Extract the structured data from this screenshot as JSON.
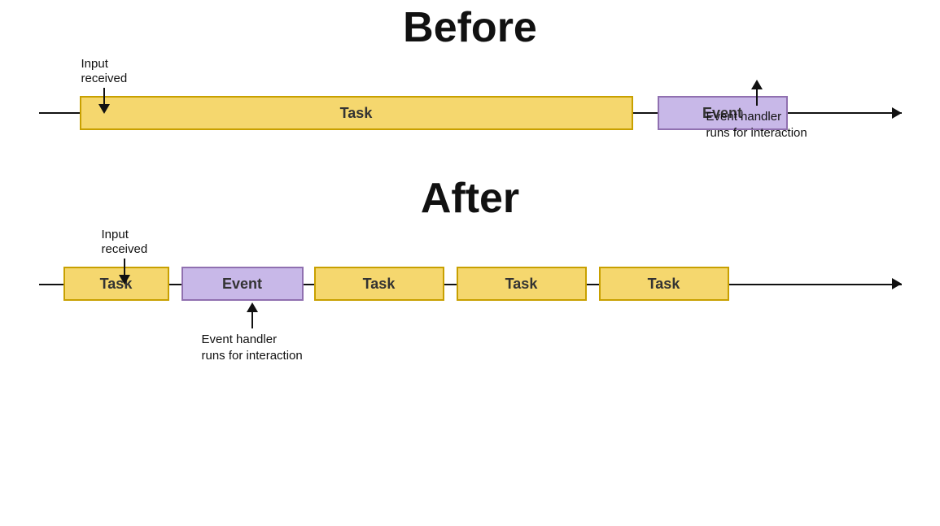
{
  "before": {
    "title": "Before",
    "input_received_label": "Input\nreceived",
    "task_label": "Task",
    "event_label": "Event",
    "event_handler_label": "Event handler\nruns for interaction"
  },
  "after": {
    "title": "After",
    "input_received_label": "Input\nreceived",
    "task_label": "Task",
    "event_label": "Event",
    "task2_label": "Task",
    "task3_label": "Task",
    "task4_label": "Task",
    "event_handler_label": "Event handler\nruns for interaction"
  },
  "colors": {
    "task_fill": "#f5d76e",
    "task_border": "#c8a000",
    "event_fill": "#c8b8e8",
    "event_border": "#9070b0",
    "text": "#111111",
    "line": "#111111"
  }
}
